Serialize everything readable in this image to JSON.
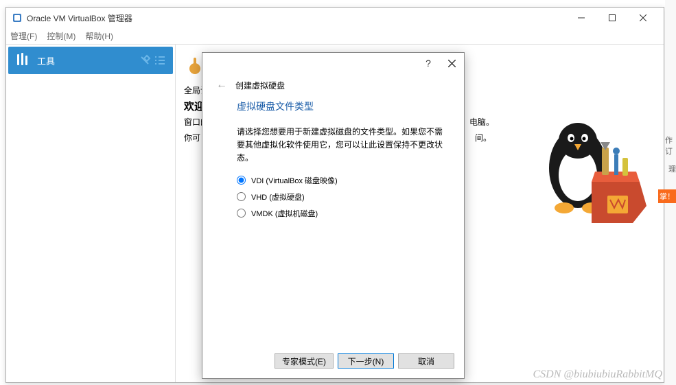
{
  "window": {
    "title": "Oracle VM VirtualBox 管理器"
  },
  "menubar": {
    "file": "管理(F)",
    "control": "控制(M)",
    "help": "帮助(H)"
  },
  "sidebar": {
    "tools_label": "工具"
  },
  "content": {
    "global_settings": "全局设",
    "welcome": "欢迎",
    "line1_left": "窗口的",
    "line1_right": "电脑。",
    "line2_left": "你可",
    "line2_right": "间。"
  },
  "dialog": {
    "title": "创建虚拟硬盘",
    "section_title": "虚拟硬盘文件类型",
    "description": "请选择您想要用于新建虚拟磁盘的文件类型。如果您不需要其他虚拟化软件使用它，您可以让此设置保持不更改状态。",
    "options": [
      {
        "label": "VDI (VirtualBox 磁盘映像)",
        "checked": true
      },
      {
        "label": "VHD (虚拟硬盘)",
        "checked": false
      },
      {
        "label": "VMDK (虚拟机磁盘)",
        "checked": false
      }
    ],
    "buttons": {
      "expert": "专家模式(E)",
      "next": "下一步(N)",
      "cancel": "取消"
    }
  },
  "edge": {
    "item1": "作订",
    "item2": "理",
    "item3": "掌！"
  },
  "watermark": "CSDN @biubiubiuRabbitMQ"
}
